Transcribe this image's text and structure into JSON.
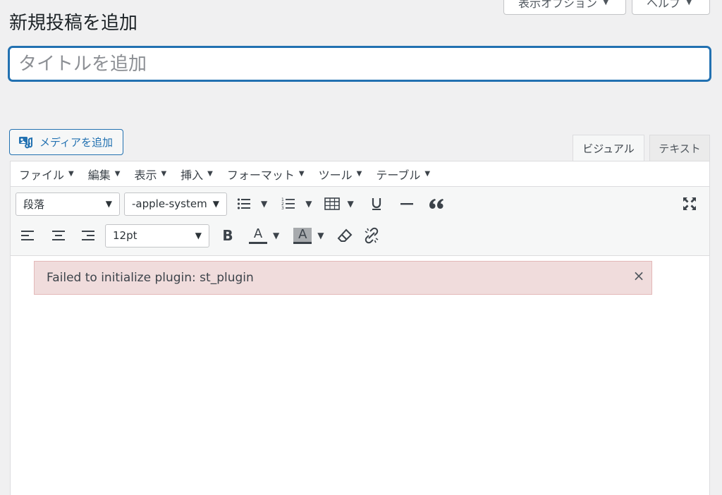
{
  "screen_meta": {
    "screen_options_label": "表示オプション",
    "help_label": "ヘルプ"
  },
  "page_title": "新規投稿を追加",
  "title_field": {
    "placeholder": "タイトルを追加",
    "value": ""
  },
  "media_button": {
    "label": "メディアを追加",
    "icon": "add-media-icon"
  },
  "editor_tabs": {
    "visual": "ビジュアル",
    "text": "テキスト",
    "active": "visual"
  },
  "menubar": [
    {
      "label": "ファイル"
    },
    {
      "label": "編集"
    },
    {
      "label": "表示"
    },
    {
      "label": "挿入"
    },
    {
      "label": "フォーマット"
    },
    {
      "label": "ツール"
    },
    {
      "label": "テーブル"
    }
  ],
  "toolbar": {
    "block_format": "段落",
    "font_family": "-apple-system",
    "font_size": "12pt",
    "bold_glyph": "B",
    "text_color_glyph": "A",
    "bg_color_glyph": "A",
    "icons": [
      "bullet-list-icon",
      "numbered-list-icon",
      "table-icon",
      "underline-icon",
      "horizontal-line-icon",
      "blockquote-icon",
      "fullscreen-icon",
      "align-left-icon",
      "align-center-icon",
      "align-right-icon",
      "bold-icon",
      "text-color-icon",
      "background-color-icon",
      "clear-formatting-icon",
      "unlink-icon"
    ]
  },
  "notice": {
    "message": "Failed to initialize plugin: st_plugin",
    "close_glyph": "×"
  },
  "colors": {
    "accent": "#2271b1",
    "notice_bg": "#f0dcdc",
    "page_bg": "#f0f0f1"
  }
}
